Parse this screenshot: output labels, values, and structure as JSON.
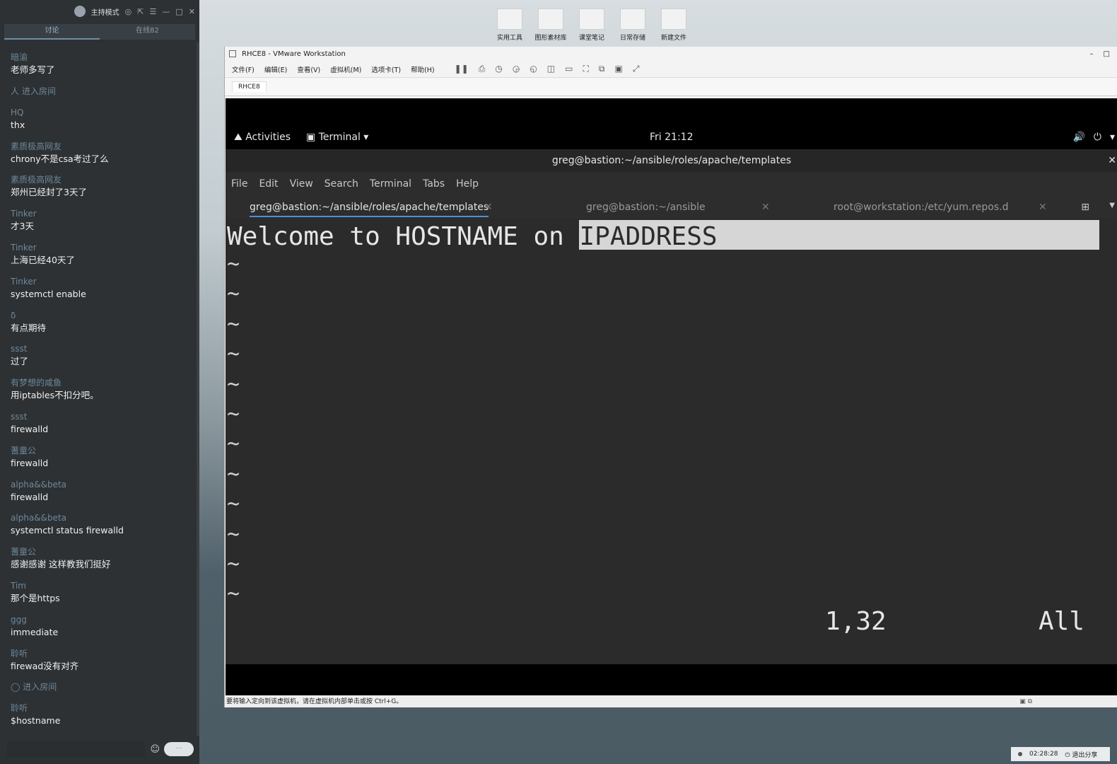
{
  "chat": {
    "mode_label": "主持模式",
    "tabs": [
      "讨论",
      "在线82"
    ],
    "messages": [
      {
        "name": "暗渝",
        "text": "老师多写了"
      },
      {
        "system": "人 进入房间"
      },
      {
        "name": "HQ",
        "text": "thx"
      },
      {
        "name": "素质极高网友",
        "text": "chrony不是csa考过了么"
      },
      {
        "name": "素质极高网友",
        "text": "郑州已经封了3天了"
      },
      {
        "name": "Tinker",
        "text": "才3天"
      },
      {
        "name": "Tinker",
        "text": "上海已经40天了"
      },
      {
        "name": "Tinker",
        "text": "systemctl enable"
      },
      {
        "name": "δ",
        "text": "有点期待"
      },
      {
        "name": "ssst",
        "text": "过了"
      },
      {
        "name": "有梦想的咸鱼",
        "text": "用iptables不扣分吧。"
      },
      {
        "name": "ssst",
        "text": "firewalld"
      },
      {
        "name": "蓍童公",
        "text": "firewalld"
      },
      {
        "name": "alpha&&beta",
        "text": "firewalld"
      },
      {
        "name": "alpha&&beta",
        "text": "systemctl status firewalld"
      },
      {
        "name": "蓍童公",
        "text": "感谢感谢  这样教我们挺好"
      },
      {
        "name": "Tim",
        "text": "那个是https"
      },
      {
        "name": "ggg",
        "text": "immediate"
      },
      {
        "name": "聆听",
        "text": "firewad没有对齐"
      },
      {
        "system": "◯ 进入房间"
      },
      {
        "name": "聆听",
        "text": "$hostname"
      }
    ]
  },
  "desktop_icons": [
    "实用工具",
    "图形素材库",
    "课堂笔记",
    "日常存储",
    "新建文件"
  ],
  "vmware": {
    "title": "RHCE8 - VMware Workstation",
    "menus": [
      "文件(F)",
      "编辑(E)",
      "查看(V)",
      "虚拟机(M)",
      "选项卡(T)",
      "帮助(H)"
    ],
    "vm_tab": "RHCE8",
    "status_text": "要将输入定向到该虚拟机，请在虚拟机内部单击或按 Ctrl+G。"
  },
  "gnome": {
    "activities": "Activities",
    "app": "Terminal",
    "clock": "Fri 21:12"
  },
  "terminal": {
    "title": "greg@bastion:~/ansible/roles/apache/templates",
    "menus": [
      "File",
      "Edit",
      "View",
      "Search",
      "Terminal",
      "Tabs",
      "Help"
    ],
    "tabs": [
      {
        "label": "greg@bastion:~/ansible/roles/apache/templates",
        "active": true
      },
      {
        "label": "greg@bastion:~/ansible",
        "active": false
      },
      {
        "label": "root@workstation:/etc/yum.repos.d",
        "active": false
      }
    ]
  },
  "vim": {
    "line_prefix": "Welcome to HOSTNAME on ",
    "line_selected": "IPADDRESS",
    "tilde": "~",
    "cursor_pos": "1,32",
    "scroll_pos": "All"
  },
  "taskbar": {
    "timer": "02:28:28",
    "exit_share": "退出分享"
  }
}
